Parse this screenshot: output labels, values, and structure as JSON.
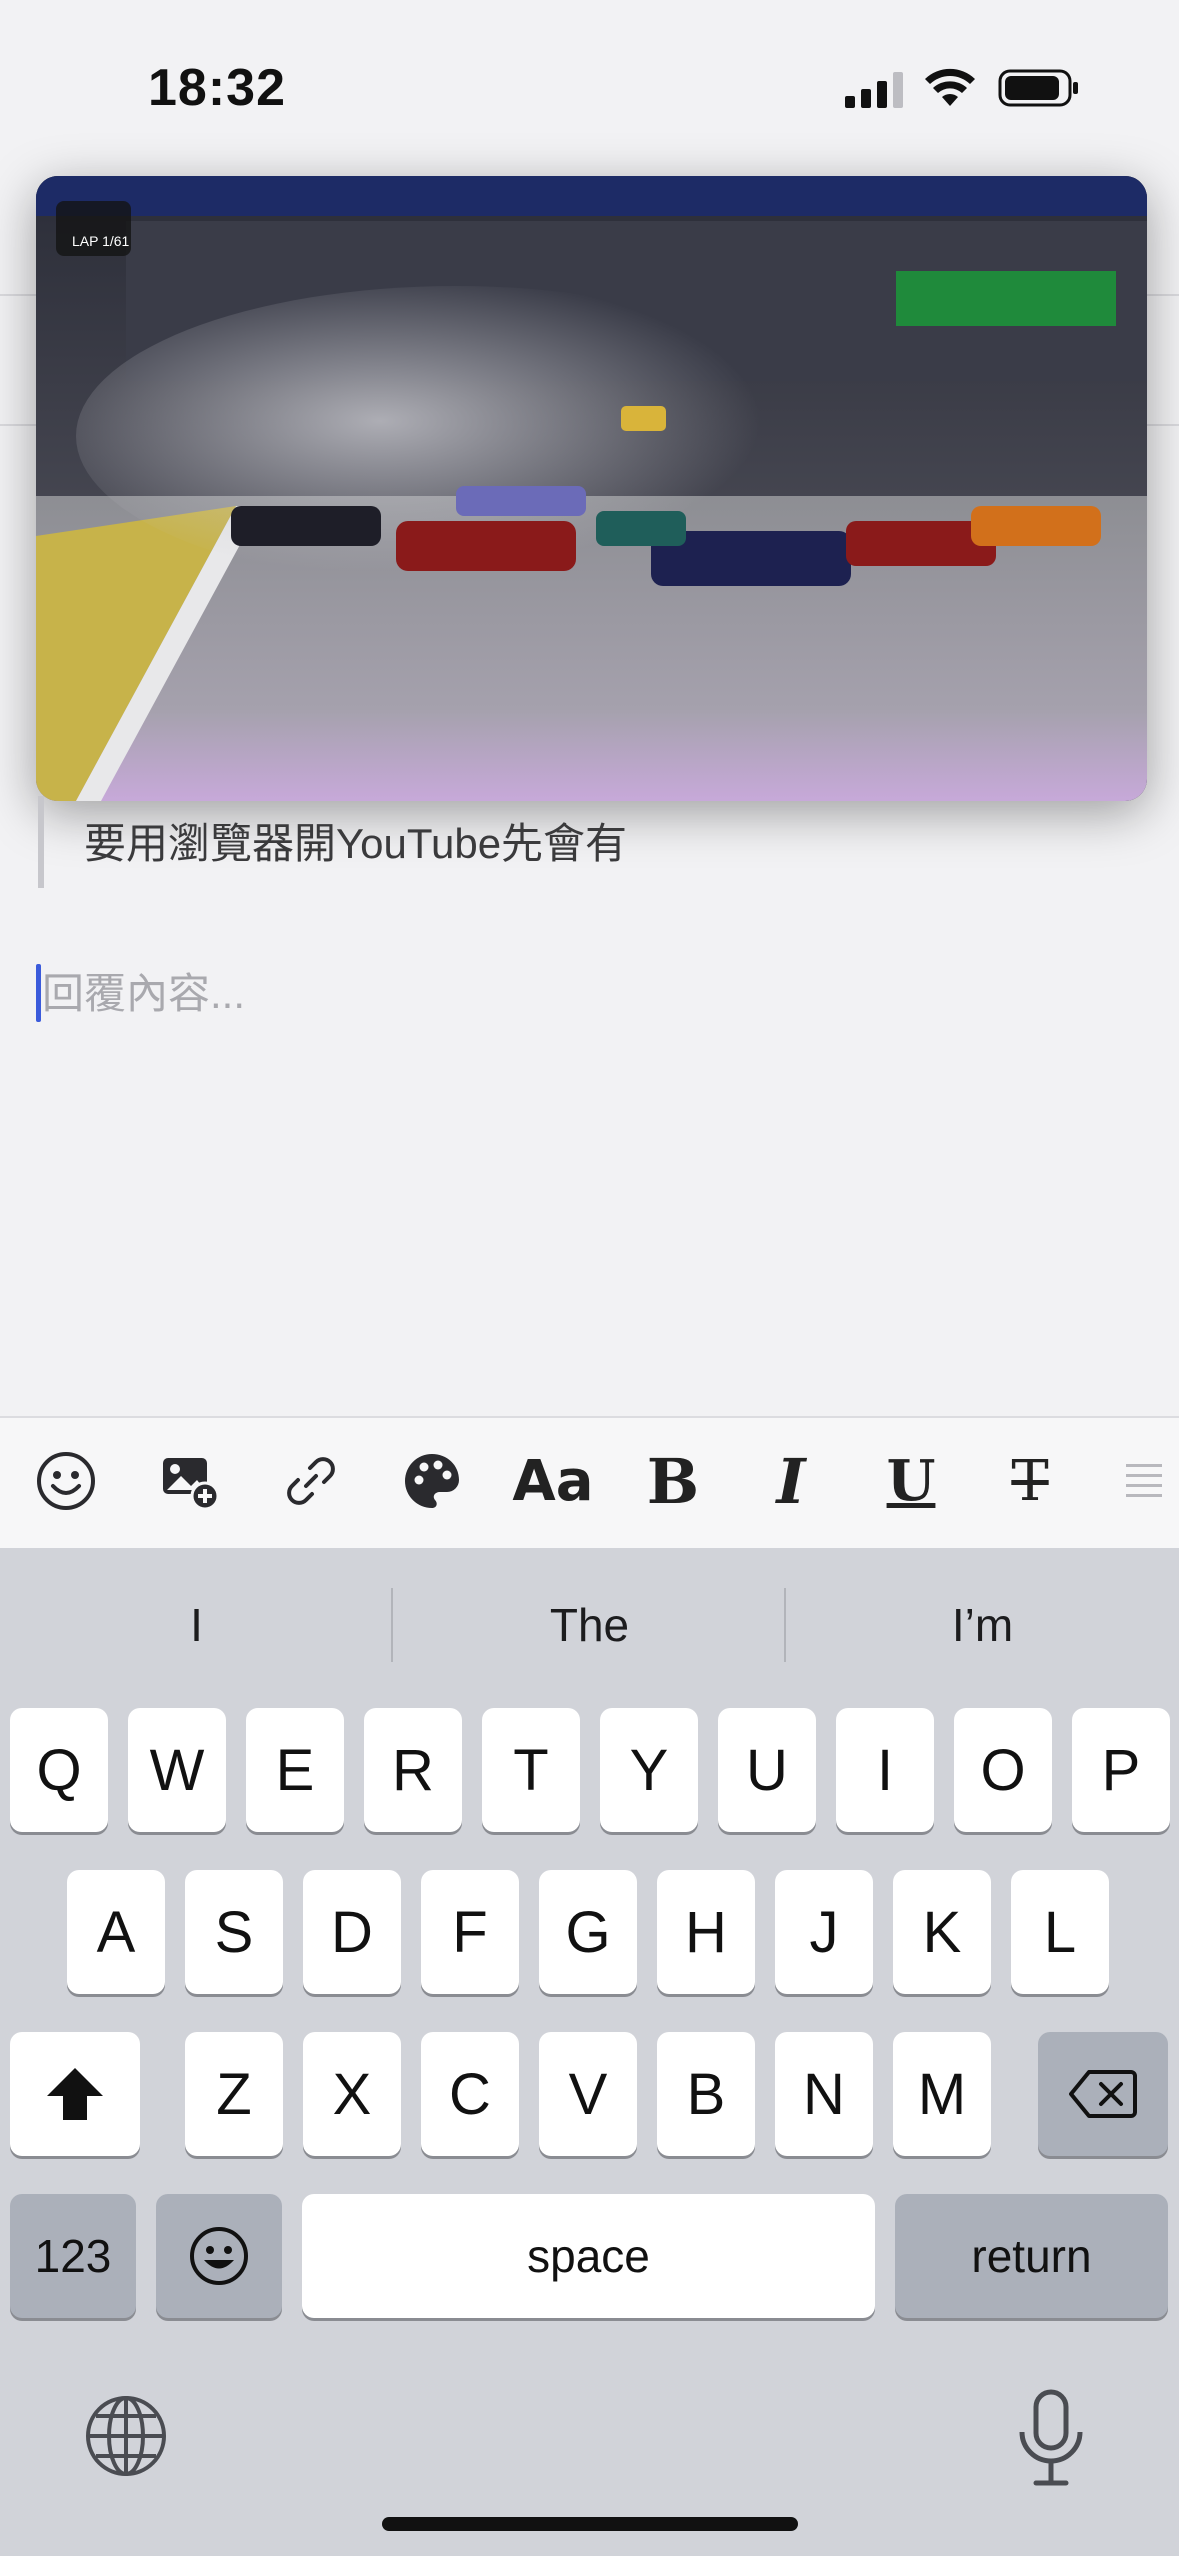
{
  "status": {
    "time": "18:32"
  },
  "video": {
    "lap_label": "LAP 1/61"
  },
  "quote": {
    "text": "要用瀏覽器開YouTube先會有"
  },
  "reply": {
    "placeholder": "回覆內容...",
    "value": ""
  },
  "toolbar": {
    "items": [
      "emoji",
      "insert-image",
      "link",
      "color-palette",
      "font-size",
      "bold",
      "italic",
      "underline",
      "strikethrough",
      "more"
    ],
    "font_size_label": "Aa",
    "bold_label": "B",
    "italic_label": "I",
    "underline_label": "U",
    "strike_label": "T"
  },
  "keyboard": {
    "suggestions": [
      "I",
      "The",
      "I’m"
    ],
    "row1": [
      "Q",
      "W",
      "E",
      "R",
      "T",
      "Y",
      "U",
      "I",
      "O",
      "P"
    ],
    "row2": [
      "A",
      "S",
      "D",
      "F",
      "G",
      "H",
      "J",
      "K",
      "L"
    ],
    "row3": [
      "Z",
      "X",
      "C",
      "V",
      "B",
      "N",
      "M"
    ],
    "numbers_label": "123",
    "space_label": "space",
    "return_label": "return"
  }
}
